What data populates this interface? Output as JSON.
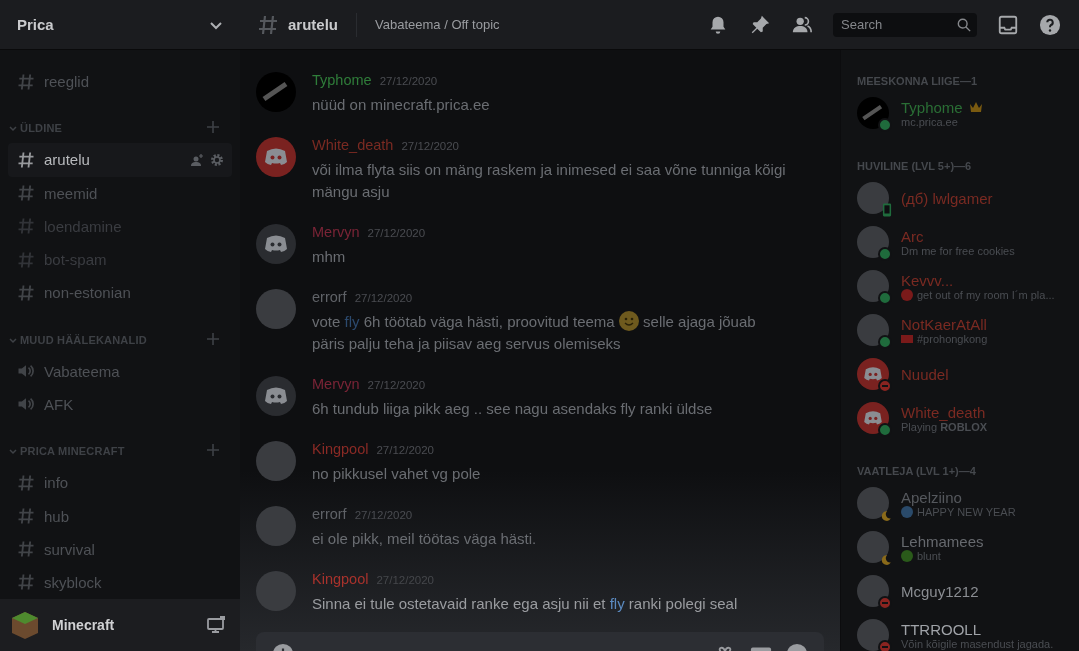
{
  "server": {
    "name": "Prica"
  },
  "header": {
    "channel": "arutelu",
    "topic": "Vabateema / Off topic",
    "search": {
      "placeholder": "Search"
    }
  },
  "sidebar": {
    "items": [
      {
        "kind": "text",
        "name": "reeglid",
        "selected": false,
        "muted": false
      },
      {
        "kind": "category",
        "name": "ÜLDINE",
        "expanded": true
      },
      {
        "kind": "text",
        "name": "arutelu",
        "selected": true,
        "muted": false
      },
      {
        "kind": "text",
        "name": "meemid",
        "selected": false,
        "muted": false
      },
      {
        "kind": "text",
        "name": "loendamine",
        "selected": false,
        "muted": true
      },
      {
        "kind": "text",
        "name": "bot-spam",
        "selected": false,
        "muted": true
      },
      {
        "kind": "text",
        "name": "non-estonian",
        "selected": false,
        "muted": false
      },
      {
        "kind": "category",
        "name": "MUUD HÄÄLEKANALID",
        "expanded": true
      },
      {
        "kind": "voice",
        "name": "Vabateema",
        "selected": false,
        "muted": false
      },
      {
        "kind": "voice",
        "name": "AFK",
        "selected": false,
        "muted": false
      },
      {
        "kind": "category",
        "name": "PRICA MINECRAFT",
        "expanded": true
      },
      {
        "kind": "text",
        "name": "info",
        "selected": false,
        "muted": false
      },
      {
        "kind": "text",
        "name": "hub",
        "selected": false,
        "muted": false
      },
      {
        "kind": "text",
        "name": "survival",
        "selected": false,
        "muted": false
      },
      {
        "kind": "text",
        "name": "skyblock",
        "selected": false,
        "muted": false
      }
    ]
  },
  "user_panel": {
    "activity": "Minecraft"
  },
  "messages": [
    {
      "author": "Typhome",
      "color": "#2f7d3a",
      "timestamp": "27/12/2020",
      "avatar": {
        "kind": "prica"
      },
      "segments": [
        {
          "kind": "text",
          "text": "nüüd on minecraft.prica.ee"
        }
      ]
    },
    {
      "author": "White_death",
      "color": "#7a2a22",
      "timestamp": "27/12/2020",
      "avatar": {
        "kind": "discord-red"
      },
      "segments": [
        {
          "kind": "text",
          "text": "või ilma flyta siis on mäng raskem ja inimesed ei saa võne tunniga kõigi mängu asju"
        }
      ]
    },
    {
      "author": "Mervyn",
      "color": "#7a2436",
      "timestamp": "27/12/2020",
      "avatar": {
        "kind": "discord-grey"
      },
      "segments": [
        {
          "kind": "text",
          "text": "mhm"
        }
      ]
    },
    {
      "author": "errorf",
      "color": "#5f6267",
      "timestamp": "27/12/2020",
      "avatar": {
        "kind": "photo"
      },
      "segments": [
        {
          "kind": "text",
          "text": "vote "
        },
        {
          "kind": "highlight",
          "text": "fly"
        },
        {
          "kind": "text",
          "text": " 6h töötab väga hästi, proovitud teema "
        },
        {
          "kind": "emoji"
        },
        {
          "kind": "text",
          "text": " selle ajaga jõuab päris palju teha ja piisav aeg servus olemiseks"
        }
      ]
    },
    {
      "author": "Mervyn",
      "color": "#7a2436",
      "timestamp": "27/12/2020",
      "avatar": {
        "kind": "discord-grey"
      },
      "segments": [
        {
          "kind": "text",
          "text": "6h tundub liiga pikk aeg .. see nagu asendaks fly ranki üldse"
        }
      ]
    },
    {
      "author": "Kingpool",
      "color": "#8a2a25",
      "timestamp": "27/12/2020",
      "avatar": {
        "kind": "photo"
      },
      "segments": [
        {
          "kind": "text",
          "text": "no pikkusel vahet vg pole"
        }
      ]
    },
    {
      "author": "errorf",
      "color": "#5f6267",
      "timestamp": "27/12/2020",
      "avatar": {
        "kind": "photo"
      },
      "segments": [
        {
          "kind": "text",
          "text": "ei ole pikk, meil töötas väga hästi."
        }
      ]
    },
    {
      "author": "Kingpool",
      "color": "#a8322c",
      "timestamp": "27/12/2020",
      "avatar": {
        "kind": "photo"
      },
      "segments": [
        {
          "kind": "text",
          "text": "Sinna ei tule ostetavaid ranke ega asju nii et "
        },
        {
          "kind": "highlight",
          "text": "fly"
        },
        {
          "kind": "text",
          "text": " ranki polegi seal"
        }
      ]
    }
  ],
  "members": [
    {
      "title": "MEESKONNA LIIGE—1",
      "members": [
        {
          "name": "Typhome",
          "color": "#2a6e35",
          "avatar": {
            "kind": "prica"
          },
          "presence": {
            "kind": "online",
            "color": "#1f6b3c"
          },
          "owner": true,
          "activity": "mc.prica.ee"
        }
      ]
    },
    {
      "title": "HUVILINE (LVL 5+)—6",
      "members": [
        {
          "name": "(дб) lwlgamer",
          "color": "#7a2a22",
          "avatar": {
            "kind": "photo"
          },
          "presence": {
            "kind": "mobile",
            "color": "#1f6b3c"
          },
          "owner": false
        },
        {
          "name": "Arc",
          "color": "#7a2a22",
          "avatar": {
            "kind": "photo"
          },
          "presence": {
            "kind": "online",
            "color": "#1f6b3c"
          },
          "owner": false,
          "activity": "Dm me for free cookies"
        },
        {
          "name": "Kevvv...",
          "color": "#7a2a22",
          "avatar": {
            "kind": "photo"
          },
          "presence": {
            "kind": "online",
            "color": "#1f6b3c"
          },
          "owner": false,
          "activity_icon": {
            "kind": "angry"
          },
          "activity": "get out of my room I´m pla..."
        },
        {
          "name": "NotKaerAtAll",
          "color": "#7a2a22",
          "avatar": {
            "kind": "photo"
          },
          "presence": {
            "kind": "online",
            "color": "#1f6b3c"
          },
          "owner": false,
          "activity_icon": {
            "kind": "flag"
          },
          "activity": "#prohongkong"
        },
        {
          "name": "Nuudel",
          "color": "#7a2a22",
          "avatar": {
            "kind": "discord-red"
          },
          "presence": {
            "kind": "dnd",
            "color": "#8a2420"
          },
          "owner": false
        },
        {
          "name": "White_death",
          "color": "#7a2a22",
          "avatar": {
            "kind": "discord-red"
          },
          "presence": {
            "kind": "online",
            "color": "#1f6b3c"
          },
          "owner": false,
          "activity": "Playing **ROBLOX**"
        }
      ]
    },
    {
      "title": "VAATLEJA (LVL 1+)—4",
      "members": [
        {
          "name": "Apelziino",
          "color": "#55585d",
          "avatar": {
            "kind": "photo"
          },
          "presence": {
            "kind": "idle",
            "color": "#8a6a1a"
          },
          "owner": false,
          "activity_icon": {
            "kind": "sparkle"
          },
          "activity": "HAPPY NEW YEAR"
        },
        {
          "name": "Lehmamees",
          "color": "#66696e",
          "avatar": {
            "kind": "photo"
          },
          "presence": {
            "kind": "idle",
            "color": "#8a6a1a"
          },
          "owner": false,
          "activity_icon": {
            "kind": "tree"
          },
          "activity": "blunt"
        },
        {
          "name": "Mcguy1212",
          "color": "#8a8d92",
          "avatar": {
            "kind": "photo"
          },
          "presence": {
            "kind": "dnd",
            "color": "#8a2420"
          },
          "owner": false
        },
        {
          "name": "TTRROOLL",
          "color": "#a0a3a8",
          "avatar": {
            "kind": "photo"
          },
          "presence": {
            "kind": "dnd",
            "color": "#8a2420"
          },
          "owner": false,
          "activity": "Võin kõigile masendust jagada."
        }
      ]
    }
  ]
}
